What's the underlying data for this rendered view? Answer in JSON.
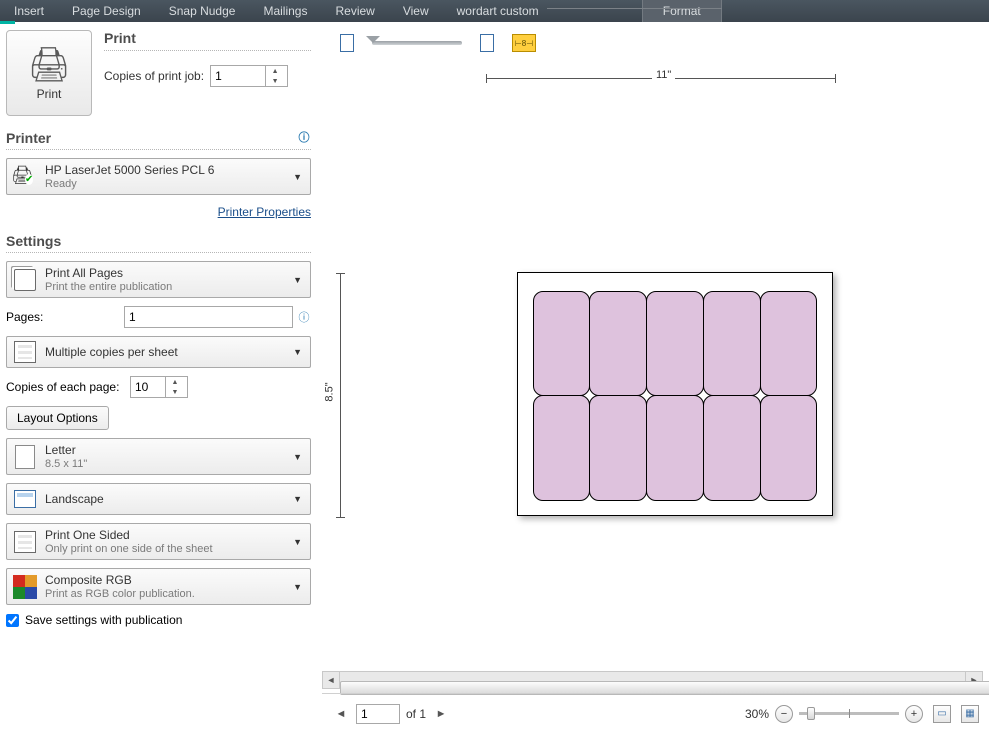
{
  "ribbon": {
    "tabs": [
      "Insert",
      "Page Design",
      "Snap Nudge",
      "Mailings",
      "Review",
      "View",
      "wordart custom"
    ],
    "format": "Format"
  },
  "print_panel": {
    "print_heading": "Print",
    "print_button": "Print",
    "copies_label": "Copies of print job:",
    "copies_value": "1"
  },
  "printer": {
    "heading": "Printer",
    "name": "HP LaserJet 5000 Series PCL 6",
    "status": "Ready",
    "properties_link": "Printer Properties"
  },
  "settings": {
    "heading": "Settings",
    "print_range": {
      "title": "Print All Pages",
      "sub": "Print the entire publication"
    },
    "pages_label": "Pages:",
    "pages_value": "1",
    "copies_mode": "Multiple copies per sheet",
    "copies_each_label": "Copies of each page:",
    "copies_each_value": "10",
    "layout_options": "Layout Options",
    "paper": {
      "title": "Letter",
      "sub": "8.5 x 11\""
    },
    "orientation": "Landscape",
    "sides": {
      "title": "Print One Sided",
      "sub": "Only print on one side of the sheet"
    },
    "color": {
      "title": "Composite RGB",
      "sub": "Print as RGB color publication."
    },
    "save_checkbox": "Save settings with publication"
  },
  "preview": {
    "ruler_width": "11\"",
    "ruler_height": "8.5\"",
    "ruler_button": "⊢8⊣"
  },
  "status": {
    "page_value": "1",
    "page_of": "of 1",
    "zoom": "30%"
  }
}
